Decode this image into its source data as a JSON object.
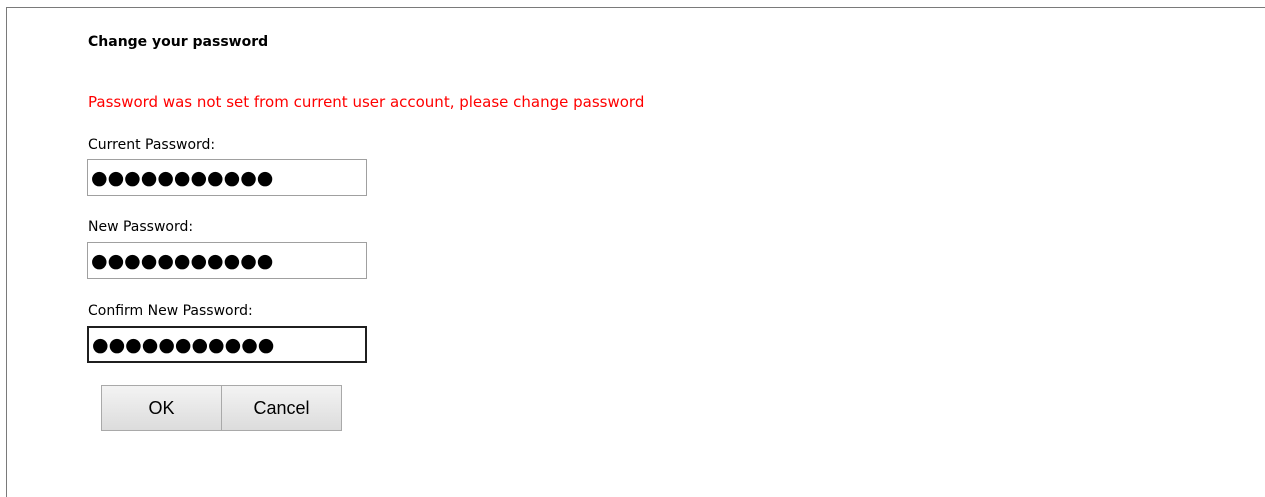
{
  "form": {
    "title": "Change your password",
    "error_message": "Password was not set from current user account, please change password",
    "error_color": "#ff0000",
    "fields": [
      {
        "label": "Current Password:",
        "value": "●●●●●●●●●●●"
      },
      {
        "label": "New Password:",
        "value": "●●●●●●●●●●●"
      },
      {
        "label": "Confirm New Password:",
        "value": "●●●●●●●●●●●"
      }
    ],
    "ok_label": "OK",
    "cancel_label": "Cancel"
  }
}
